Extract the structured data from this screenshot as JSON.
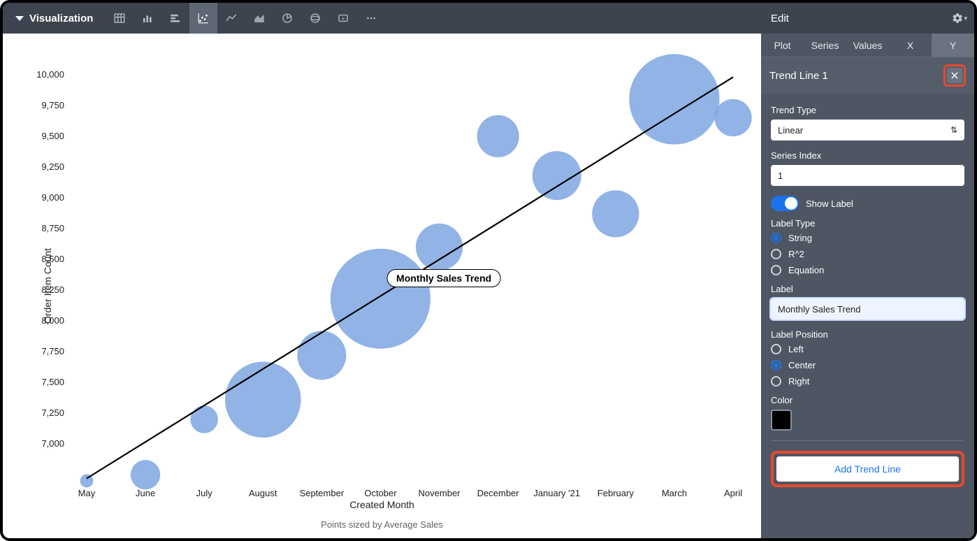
{
  "viz_title": "Visualization",
  "edit_title": "Edit",
  "tabs": [
    "Plot",
    "Series",
    "Values",
    "X",
    "Y"
  ],
  "active_tab_index": 4,
  "section_title": "Trend Line 1",
  "trend_type_label": "Trend Type",
  "trend_type_value": "Linear",
  "series_index_label": "Series Index",
  "series_index_value": "1",
  "show_label_text": "Show Label",
  "label_type_label": "Label Type",
  "label_type_options": [
    "String",
    "R^2",
    "Equation"
  ],
  "label_type_selected": "String",
  "label_field_label": "Label",
  "label_field_value": "Monthly Sales Trend",
  "label_position_label": "Label Position",
  "label_position_options": [
    "Left",
    "Center",
    "Right"
  ],
  "label_position_selected": "Center",
  "color_label": "Color",
  "color_value": "#000000",
  "add_btn_label": "Add Trend Line",
  "chart_data": {
    "type": "scatter",
    "xlabel": "Created Month",
    "ylabel": "Order Item Count",
    "size_note": "Points sized by Average Sales",
    "categories": [
      "May",
      "June",
      "July",
      "August",
      "September",
      "October",
      "November",
      "December",
      "January '21",
      "February",
      "March",
      "April"
    ],
    "y_values": [
      6700,
      6750,
      7200,
      7360,
      7720,
      8180,
      8600,
      9500,
      9180,
      8870,
      9800,
      9650
    ],
    "bubble_rel_size": [
      0.05,
      0.22,
      0.2,
      0.7,
      0.42,
      0.95,
      0.4,
      0.35,
      0.42,
      0.4,
      0.85,
      0.3
    ],
    "y_ticks": [
      7000,
      7250,
      7500,
      7750,
      8000,
      8250,
      8500,
      8750,
      9000,
      9250,
      9500,
      9750,
      10000
    ],
    "trend": {
      "label": "Monthly Sales Trend",
      "y_start": 6720,
      "y_end": 9980
    },
    "colors": {
      "bubble": "#7ea6e0",
      "trend": "#000000"
    }
  }
}
